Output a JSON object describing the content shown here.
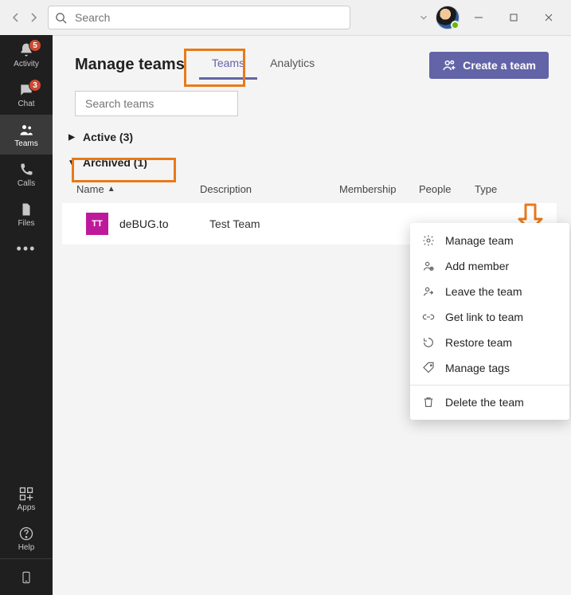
{
  "titlebar": {
    "search_placeholder": "Search"
  },
  "rail": {
    "items": [
      {
        "label": "Activity",
        "badge": "5"
      },
      {
        "label": "Chat",
        "badge": "3"
      },
      {
        "label": "Teams"
      },
      {
        "label": "Calls"
      },
      {
        "label": "Files"
      }
    ],
    "bottom": [
      {
        "label": "Apps"
      },
      {
        "label": "Help"
      }
    ]
  },
  "page": {
    "title": "Manage teams",
    "tabs": {
      "teams": "Teams",
      "analytics": "Analytics"
    },
    "create_label": "Create a team",
    "search_placeholder": "Search teams",
    "sections": {
      "active_label": "Active (3)",
      "archived_label": "Archived (1)"
    },
    "columns": {
      "name": "Name",
      "description": "Description",
      "membership": "Membership",
      "people": "People",
      "type": "Type"
    },
    "rows": [
      {
        "avatar_initials": "TT",
        "name": "deBUG.to",
        "description": "Test Team"
      }
    ]
  },
  "context_menu": {
    "manage_team": "Manage team",
    "add_member": "Add member",
    "leave_team": "Leave the team",
    "get_link": "Get link to team",
    "restore_team": "Restore team",
    "manage_tags": "Manage tags",
    "delete_team": "Delete the team"
  }
}
